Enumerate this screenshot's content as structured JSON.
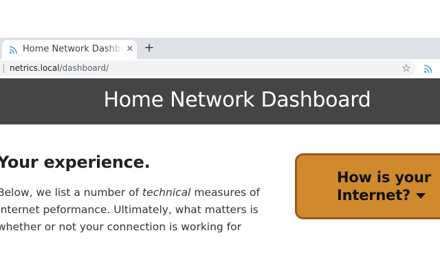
{
  "browser": {
    "tab": {
      "title": "Home Network Dashboard",
      "favicon": "wifi-icon",
      "close_icon": "close-icon"
    },
    "new_tab_icon": "plus-icon",
    "address_bar": {
      "host": "netrics.local",
      "path": "/dashboard/"
    },
    "bookmark_icon": "star-icon",
    "extension_icon": "wifi-icon"
  },
  "page": {
    "header": {
      "title": "Home Network Dashboard",
      "background": "#454545"
    },
    "section": {
      "heading": "Your experience.",
      "intro_lines": [
        {
          "before": "Below, we list a number of ",
          "emphasis": "technical",
          "after": " measures of"
        },
        {
          "text": "Internet peformance. Ultimately, what matters is"
        },
        {
          "text": "whether or not your connection is working for"
        }
      ]
    },
    "callout": {
      "line1": "How is your",
      "line2": "Internet?",
      "caret_icon": "caret-down-icon",
      "background": "#d08a2d",
      "border": "#a3541d"
    }
  }
}
